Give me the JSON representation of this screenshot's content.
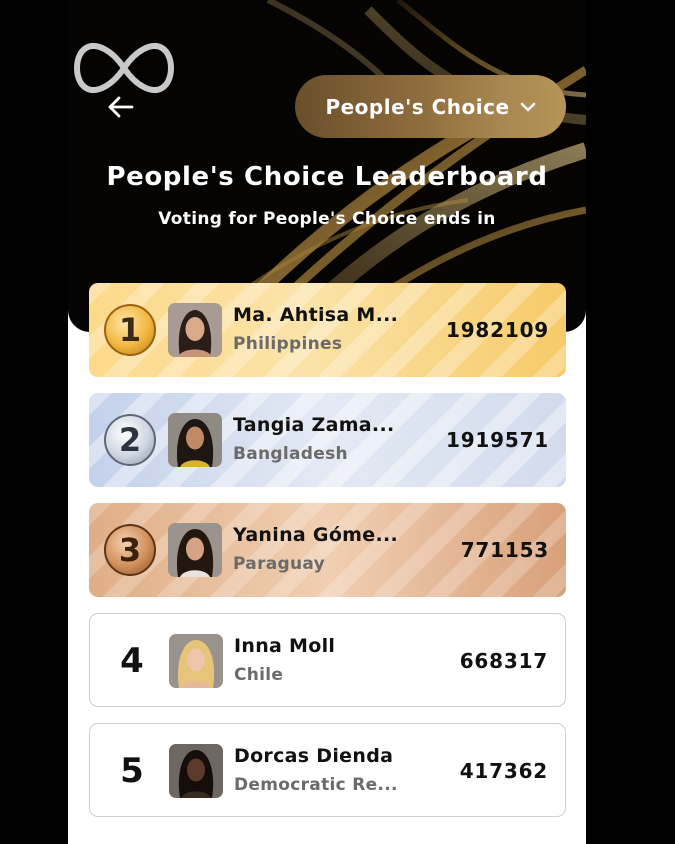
{
  "header": {
    "category_button_label": "People's Choice",
    "title": "People's Choice Leaderboard",
    "subtitle": "Voting for People's Choice ends in"
  },
  "leaderboard": [
    {
      "rank": "1",
      "name": "Ma. Ahtisa M...",
      "country": "Philippines",
      "votes": "1982109",
      "tier": "gold"
    },
    {
      "rank": "2",
      "name": "Tangia Zama...",
      "country": "Bangladesh",
      "votes": "1919571",
      "tier": "silver"
    },
    {
      "rank": "3",
      "name": "Yanina Góme...",
      "country": "Paraguay",
      "votes": "771153",
      "tier": "bronze"
    },
    {
      "rank": "4",
      "name": "Inna Moll",
      "country": "Chile",
      "votes": "668317",
      "tier": "plain"
    },
    {
      "rank": "5",
      "name": "Dorcas Dienda",
      "country": "Democratic Re...",
      "votes": "417362",
      "tier": "plain"
    }
  ],
  "icons": {
    "logo": "infinity-heart-logo",
    "back": "back-arrow-icon",
    "dropdown": "chevron-down-icon"
  },
  "colors": {
    "gold_accent": "#f2b640",
    "silver_accent": "#cfd6e2",
    "bronze_accent": "#d08f5c",
    "category_button": "#8e6d3d"
  }
}
